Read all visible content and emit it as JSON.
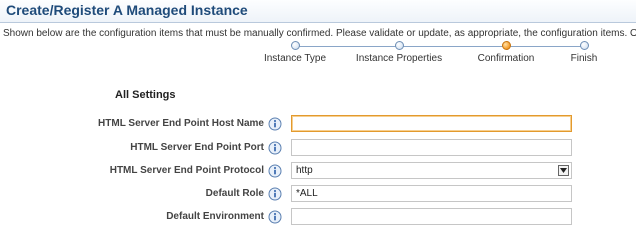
{
  "page": {
    "title": "Create/Register A Managed Instance",
    "instructions": "Shown below are the configuration items that must be manually confirmed. Please validate or update, as appropriate, the configuration items. Once complete select 'C"
  },
  "train": {
    "steps": [
      {
        "label": "Instance Type",
        "state": "visited"
      },
      {
        "label": "Instance Properties",
        "state": "visited"
      },
      {
        "label": "Confirmation",
        "state": "current"
      },
      {
        "label": "Finish",
        "state": "unvisited"
      }
    ]
  },
  "settings": {
    "section_title": "All Settings",
    "fields": [
      {
        "label": "HTML Server End Point Host Name",
        "value": "",
        "type": "text",
        "focused": true
      },
      {
        "label": "HTML Server End Point Port",
        "value": "",
        "type": "text"
      },
      {
        "label": "HTML Server End Point Protocol",
        "value": "http",
        "type": "select"
      },
      {
        "label": "Default Role",
        "value": "*ALL",
        "type": "text"
      },
      {
        "label": "Default Environment",
        "value": "",
        "type": "text"
      }
    ]
  },
  "colors": {
    "title_text": "#1f4b7a",
    "focus_border": "#e39a2e",
    "current_step": "#f7a437"
  },
  "icons": {
    "info": "info-icon",
    "dropdown": "chevron-down-icon"
  }
}
